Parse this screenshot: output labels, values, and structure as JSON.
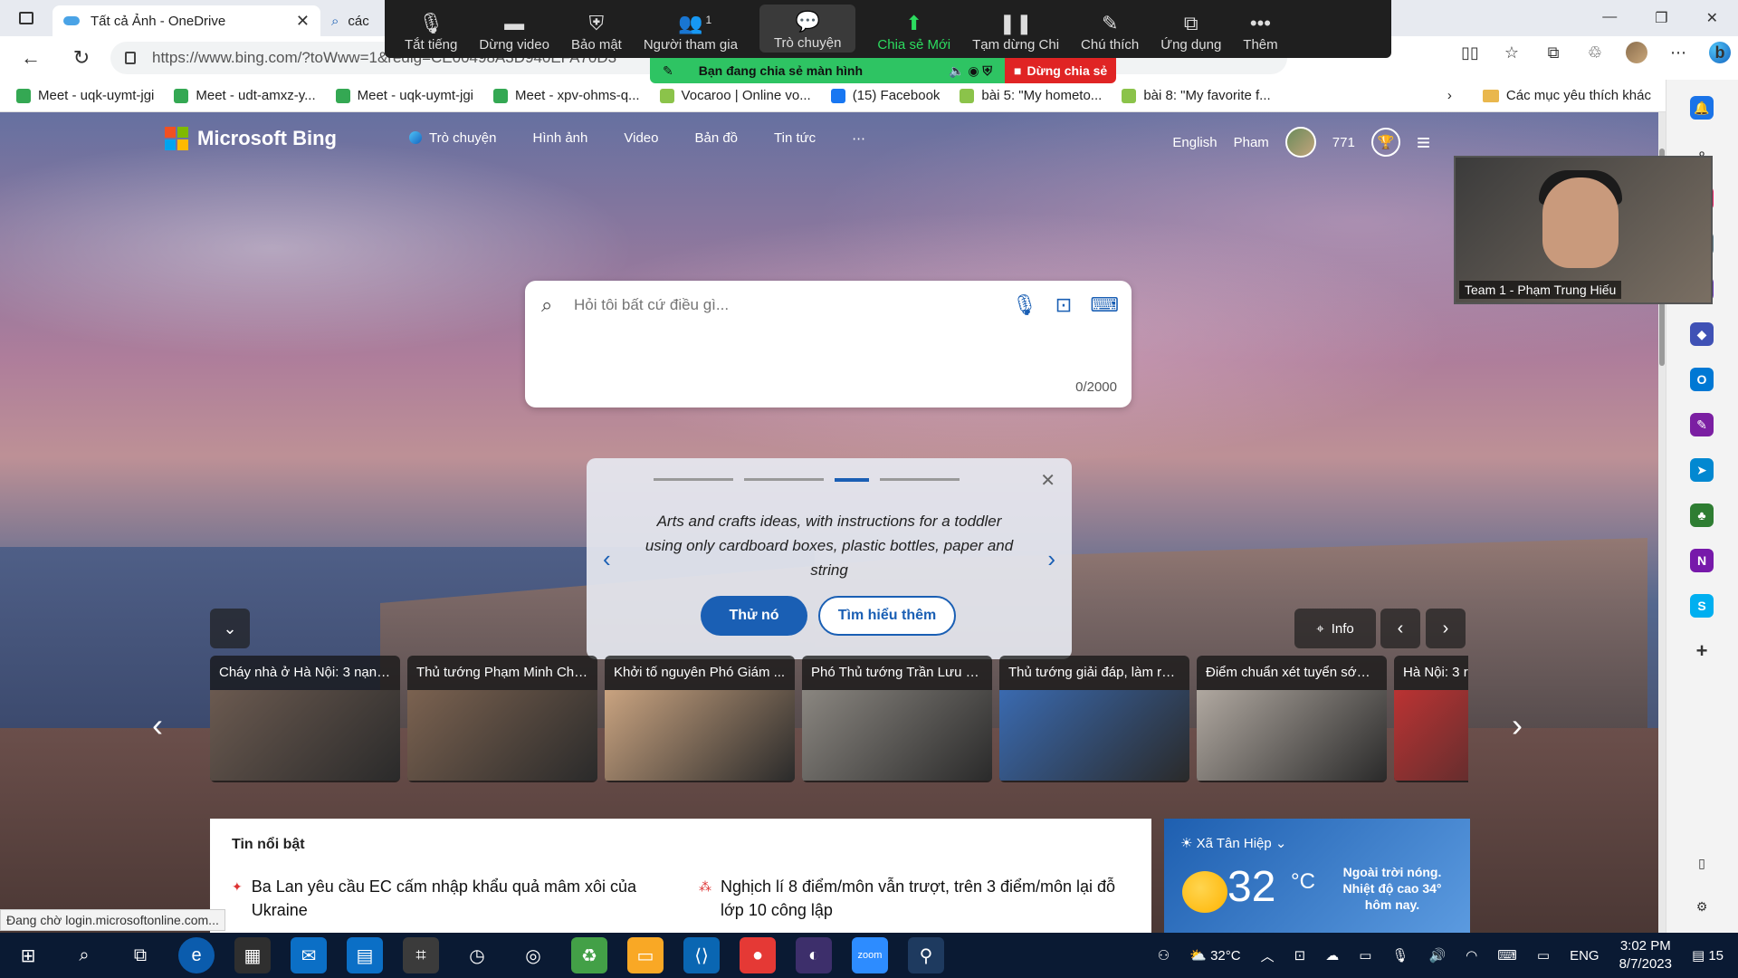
{
  "tabs": [
    {
      "title": "Tất cả Ảnh - OneDrive",
      "active": true
    },
    {
      "title": "các",
      "active": false
    }
  ],
  "address": {
    "url": "https://www.bing.com/?toWww=1&redig=CE00498A3D940EFA70D3"
  },
  "favorites": [
    {
      "label": "Meet - uqk-uymt-jgi",
      "color": "#34a853"
    },
    {
      "label": "Meet - udt-amxz-y...",
      "color": "#34a853"
    },
    {
      "label": "Meet - uqk-uymt-jgi",
      "color": "#34a853"
    },
    {
      "label": "Meet - xpv-ohms-q...",
      "color": "#34a853"
    },
    {
      "label": "Vocaroo | Online vo...",
      "color": "#8bc34a"
    },
    {
      "label": "(15) Facebook",
      "color": "#1877f2"
    },
    {
      "label": "bài 5: \"My hometo...",
      "color": "#8bc34a"
    },
    {
      "label": "bài 8: \"My favorite f...",
      "color": "#8bc34a"
    }
  ],
  "favorites_more": "Các mục yêu thích khác",
  "zoom": {
    "items": [
      {
        "label": "Tắt tiếng",
        "icon": "mic-icon",
        "glyph": "🎙"
      },
      {
        "label": "Dừng video",
        "icon": "video-icon",
        "glyph": "▬"
      },
      {
        "label": "Bảo mật",
        "icon": "shield-icon",
        "glyph": "⛨"
      },
      {
        "label": "Người tham gia",
        "icon": "participants-icon",
        "glyph": "👥",
        "count": "1"
      },
      {
        "label": "Trò chuyện",
        "icon": "chat-icon",
        "glyph": "💬"
      },
      {
        "label": "Chia sẻ Mới",
        "icon": "share-icon",
        "glyph": "⬆"
      },
      {
        "label": "Tạm dừng Chi",
        "icon": "pause-icon",
        "glyph": "❚❚"
      },
      {
        "label": "Chú thích",
        "icon": "annotate-icon",
        "glyph": "✎"
      },
      {
        "label": "Ứng dụng",
        "icon": "apps-icon",
        "glyph": "⧉"
      },
      {
        "label": "Thêm",
        "icon": "more-icon",
        "glyph": "•••"
      }
    ],
    "sharing_text": "Bạn đang chia sẻ màn hình",
    "stop_share": "Dừng chia sẻ"
  },
  "bing": {
    "brand": "Microsoft Bing",
    "nav": [
      "Trò chuyện",
      "Hình ảnh",
      "Video",
      "Bản đồ",
      "Tin tức",
      "⋯"
    ],
    "language": "English",
    "user": "Pham",
    "points": "771",
    "search_placeholder": "Hỏi tôi bất cứ điều gì...",
    "char_count": "0/2000"
  },
  "promo": {
    "text": "Arts and crafts ideas, with instructions for a toddler using only cardboard boxes, plastic bottles, paper and string",
    "try_label": "Thử nó",
    "learn_label": "Tìm hiểu thêm",
    "active_step": 3,
    "steps": 4
  },
  "info_label": "Info",
  "news": [
    {
      "title": "Cháy nhà ở Hà Nội: 3 nạn ...",
      "color": "#6b5a50"
    },
    {
      "title": "Thủ tướng Phạm Minh Chí...",
      "color": "#7b6250"
    },
    {
      "title": "Khởi tố nguyên Phó Giám ...",
      "color": "#c9a380"
    },
    {
      "title": "Phó Thủ tướng Trần Lưu Q...",
      "color": "#8a8680"
    },
    {
      "title": "Thủ tướng giải đáp, làm rõ ...",
      "color": "#3a6ab0"
    },
    {
      "title": "Điểm chuẩn xét tuyển sớm...",
      "color": "#b0a8a0"
    },
    {
      "title": "Hà Nội: 3 r",
      "color": "#b33"
    }
  ],
  "highlights": {
    "title": "Tin nổi bật",
    "items": [
      {
        "text": "Ba Lan yêu cầu EC cấm nhập khẩu quả mâm xôi của Ukraine"
      },
      {
        "text": "Nghịch lí 8 điểm/môn vẫn trượt, trên 3 điểm/môn lại đỗ lớp 10 công lập"
      }
    ]
  },
  "weather": {
    "location": "Xã Tân Hiệp",
    "temp": "32",
    "unit": "°C",
    "note": "Ngoài trời nóng. Nhiệt độ cao 34° hôm nay."
  },
  "status_text": "Đang chờ login.microsoftonline.com...",
  "video_name": "Team 1 - Phạm Trung Hiếu",
  "taskbar": {
    "temp": "32°C",
    "lang": "ENG",
    "time": "3:02 PM",
    "date": "8/7/2023",
    "notif_count": "15"
  }
}
